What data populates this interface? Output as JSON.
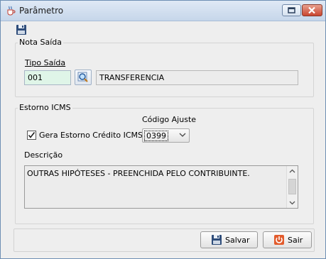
{
  "window": {
    "title": "Parâmetro"
  },
  "icons": {
    "app": "java-cup-icon",
    "save": "floppy-disk-icon",
    "lookup": "magnifier-icon",
    "exit": "power-icon"
  },
  "nota_saida": {
    "legend": "Nota Saída",
    "tipo_saida_label": "Tipo Saída",
    "code": "001",
    "description": "TRANSFERENCIA"
  },
  "estorno_icms": {
    "legend": "Estorno ICMS",
    "checkbox_label": "Gera Estorno Crédito ICMS",
    "checked": true,
    "codigo_ajuste_label": "Código Ajuste",
    "codigo_ajuste_value": "0399",
    "descricao_label": "Descrição",
    "descricao_text": "OUTRAS HIPÓTESES - PREENCHIDA PELO CONTRIBUINTE."
  },
  "buttons": {
    "save": "Salvar",
    "exit": "Sair"
  },
  "colors": {
    "code_field_bg": "#dff5e8",
    "exit_icon": "#e25b2c"
  }
}
